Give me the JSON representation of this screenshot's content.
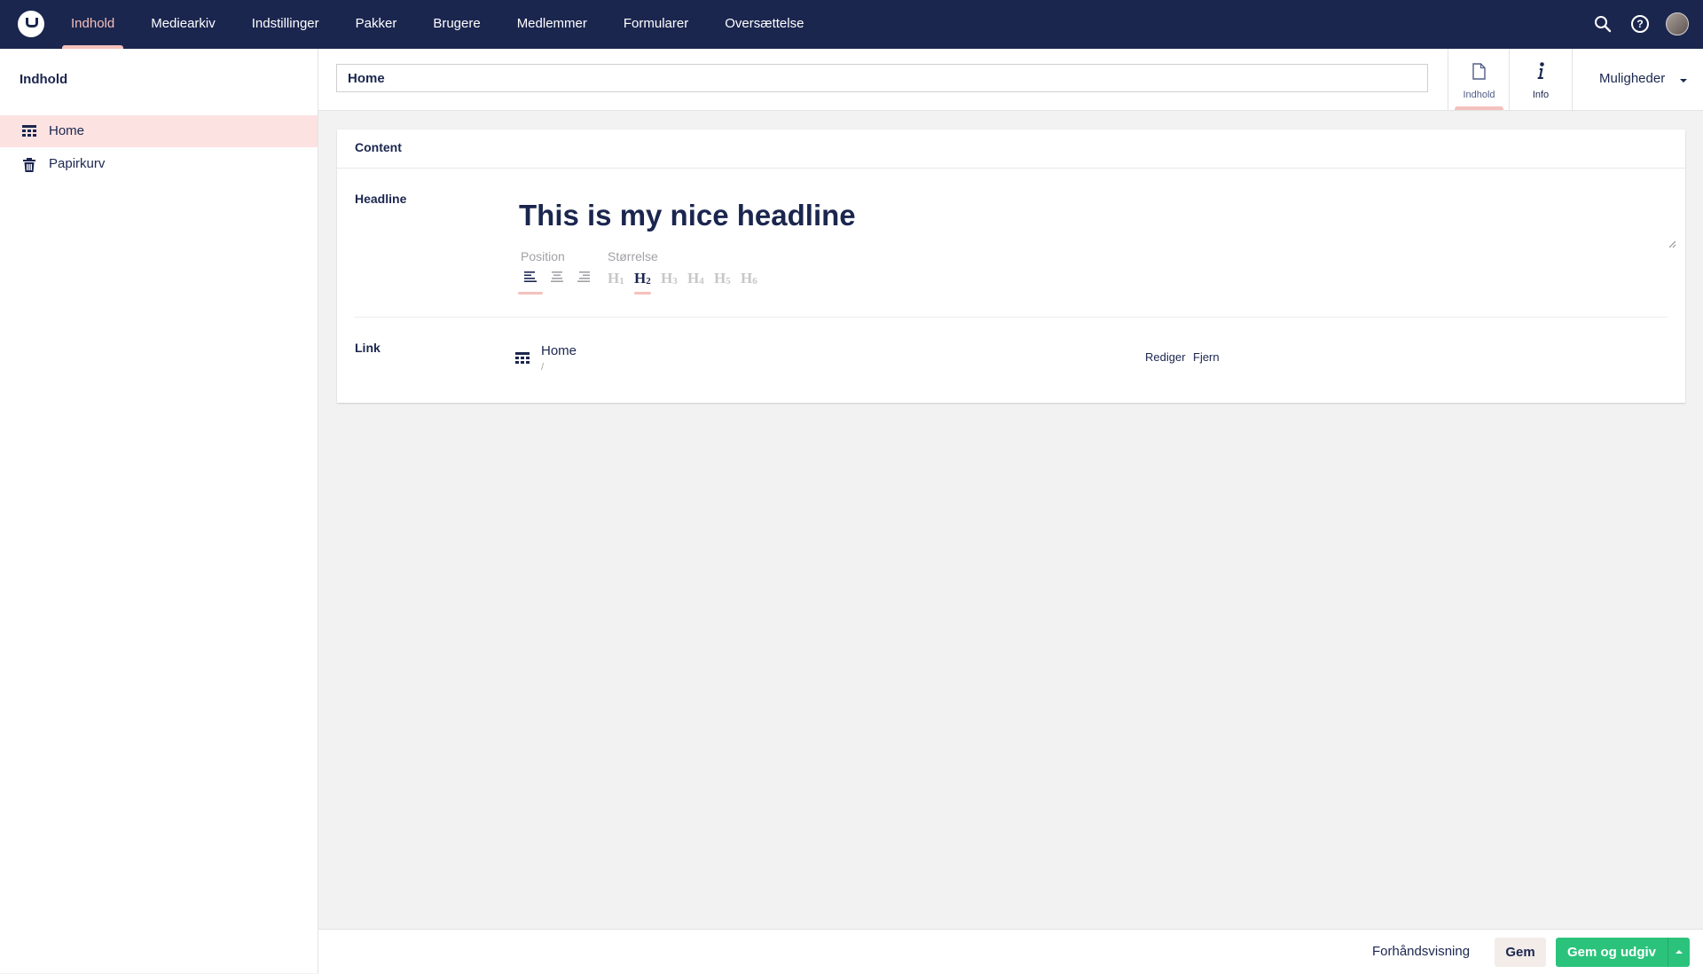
{
  "topbar": {
    "nav": [
      "Indhold",
      "Mediearkiv",
      "Indstillinger",
      "Pakker",
      "Brugere",
      "Medlemmer",
      "Formularer",
      "Oversættelse"
    ],
    "active_index": 0,
    "icons": [
      "search-icon",
      "help-icon",
      "avatar"
    ]
  },
  "sidebar": {
    "title": "Indhold",
    "items": [
      {
        "label": "Home",
        "icon": "grid-icon",
        "selected": true
      },
      {
        "label": "Papirkurv",
        "icon": "trash-icon",
        "selected": false
      }
    ]
  },
  "header": {
    "name_value": "Home",
    "apps": [
      {
        "label": "Indhold",
        "icon": "document-icon",
        "active": true
      },
      {
        "label": "Info",
        "icon": "info-icon",
        "active": false
      }
    ],
    "options_label": "Muligheder"
  },
  "content": {
    "group_title": "Content",
    "headline_label": "Headline",
    "headline_value": "This is my nice headline",
    "position_label": "Position",
    "size_label": "Størrelse",
    "alignments": [
      "align-left",
      "align-center",
      "align-right"
    ],
    "active_alignment": "align-left",
    "sizes": [
      {
        "letter": "H",
        "num": "1"
      },
      {
        "letter": "H",
        "num": "2"
      },
      {
        "letter": "H",
        "num": "3"
      },
      {
        "letter": "H",
        "num": "4"
      },
      {
        "letter": "H",
        "num": "5"
      },
      {
        "letter": "H",
        "num": "6"
      }
    ],
    "active_size": "H2",
    "link_label": "Link",
    "link": {
      "name": "Home",
      "url": "/",
      "edit": "Rediger",
      "remove": "Fjern"
    }
  },
  "footer": {
    "preview": "Forhåndsvisning",
    "save": "Gem",
    "save_publish": "Gem og udgiv"
  },
  "colors": {
    "topbar": "#1b264f",
    "accent": "#f5c1bc",
    "publish": "#2bc37c",
    "selected_row": "#fce2e1"
  }
}
